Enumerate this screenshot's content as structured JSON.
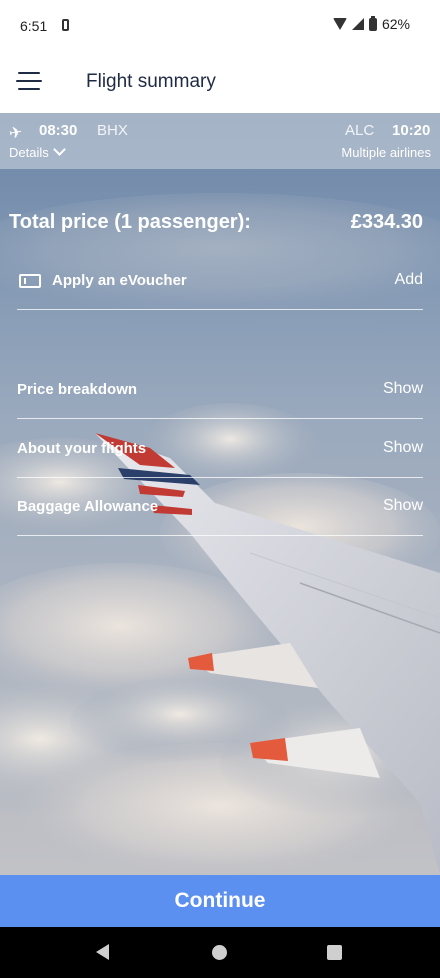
{
  "status": {
    "time": "6:51",
    "battery": "62%"
  },
  "header": {
    "title": "Flight summary"
  },
  "flight": {
    "departure_time": "08:30",
    "departure_code": "BHX",
    "arrival_code": "ALC",
    "arrival_time": "10:20",
    "details_label": "Details",
    "airlines": "Multiple airlines"
  },
  "total": {
    "label": "Total price (1 passenger):",
    "value": "£334.30"
  },
  "voucher": {
    "label": "Apply an eVoucher",
    "action": "Add"
  },
  "sections": [
    {
      "label": "Price breakdown",
      "action": "Show"
    },
    {
      "label": "About your flights",
      "action": "Show"
    },
    {
      "label": "Baggage Allowance",
      "action": "Show"
    }
  ],
  "footer": {
    "continue_label": "Continue"
  },
  "colors": {
    "accent": "#5b8ff0",
    "header_text": "#1f2a44",
    "nav_bar": "#000000"
  }
}
